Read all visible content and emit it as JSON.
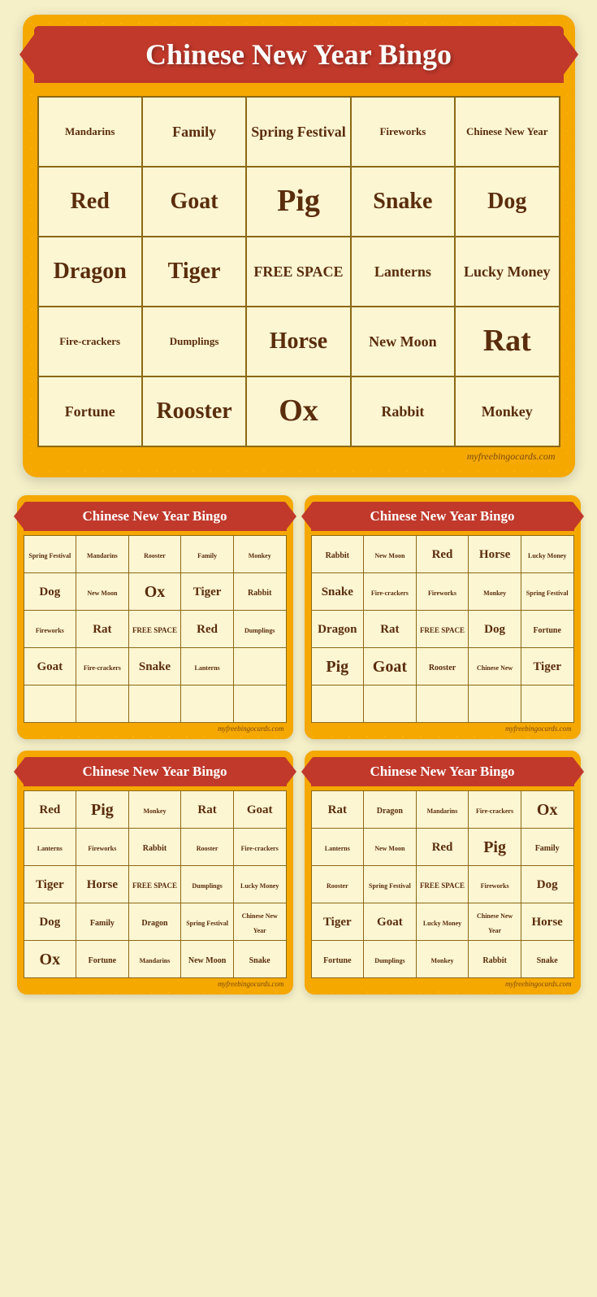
{
  "site": "myfreebingocards.com",
  "mainCard": {
    "title": "Chinese New Year Bingo",
    "rows": [
      [
        "Mandarins",
        "Family",
        "Spring Festival",
        "Fireworks",
        "Chinese New Year"
      ],
      [
        "Red",
        "Goat",
        "Pig",
        "Snake",
        "Dog"
      ],
      [
        "Dragon",
        "Tiger",
        "FREE SPACE",
        "Lanterns",
        "Lucky Money"
      ],
      [
        "Fire-crackers",
        "Dumplings",
        "Horse",
        "New Moon",
        "Rat"
      ],
      [
        "Fortune",
        "Rooster",
        "Ox",
        "Rabbit",
        "Monkey"
      ]
    ],
    "sizes": [
      [
        "sm",
        "md",
        "md",
        "sm",
        "sm"
      ],
      [
        "lg",
        "lg",
        "xl",
        "lg",
        "lg"
      ],
      [
        "lg",
        "lg",
        "free",
        "md",
        "md"
      ],
      [
        "sm",
        "sm",
        "lg",
        "md",
        "xl"
      ],
      [
        "md",
        "lg",
        "xl",
        "md",
        "md"
      ]
    ]
  },
  "card2": {
    "title": "Chinese New Year Bingo",
    "rows": [
      [
        "Spring Festival",
        "Mandarins",
        "Rooster",
        "Family",
        "Monkey"
      ],
      [
        "Dog",
        "New Moon",
        "Ox",
        "Tiger",
        "Rabbit"
      ],
      [
        "Fireworks",
        "Rat",
        "FREE SPACE",
        "Red",
        "Dumplings"
      ],
      [
        "Goat",
        "Fire-crackers",
        "Snake",
        "Lanterns",
        ""
      ],
      [
        "",
        "",
        "",
        "",
        ""
      ]
    ],
    "sizes": [
      [
        "sm",
        "sm",
        "sm",
        "sm",
        "sm"
      ],
      [
        "lg",
        "sm",
        "xl",
        "lg",
        "md"
      ],
      [
        "sm",
        "lg",
        "free",
        "lg",
        "sm"
      ],
      [
        "lg",
        "sm",
        "lg",
        "sm",
        "sm"
      ],
      [
        "sm",
        "sm",
        "sm",
        "sm",
        "sm"
      ]
    ]
  },
  "card3": {
    "title": "Chinese New Year Bingo",
    "rows": [
      [
        "Rabbit",
        "New Moon",
        "Red",
        "Horse",
        "Lucky Money"
      ],
      [
        "Snake",
        "Fire-crackers",
        "Fireworks",
        "Monkey",
        "Spring Festival"
      ],
      [
        "Dragon",
        "Rat",
        "FREE SPACE",
        "Dog",
        "Fortune"
      ],
      [
        "Pig",
        "Goat",
        "Rooster",
        "Chinese New",
        "Tiger"
      ],
      [
        "",
        "",
        "",
        "",
        ""
      ]
    ],
    "sizes": [
      [
        "md",
        "sm",
        "lg",
        "lg",
        "sm"
      ],
      [
        "lg",
        "sm",
        "sm",
        "sm",
        "sm"
      ],
      [
        "lg",
        "lg",
        "free",
        "lg",
        "md"
      ],
      [
        "xl",
        "xl",
        "md",
        "sm",
        "lg"
      ],
      [
        "sm",
        "sm",
        "sm",
        "sm",
        "sm"
      ]
    ]
  },
  "card4": {
    "title": "Chinese New Year Bingo",
    "rows": [
      [
        "Red",
        "Pig",
        "Monkey",
        "Rat",
        "Goat"
      ],
      [
        "Lanterns",
        "Fireworks",
        "Rabbit",
        "Rooster",
        "Fire-crackers"
      ],
      [
        "Tiger",
        "Horse",
        "FREE SPACE",
        "Dumplings",
        "Lucky Money"
      ],
      [
        "Dog",
        "Family",
        "Dragon",
        "Spring Festival",
        "Chinese New Year"
      ],
      [
        "Ox",
        "Fortune",
        "Mandarins",
        "New Moon",
        "Snake"
      ]
    ],
    "sizes": [
      [
        "lg",
        "xl",
        "sm",
        "lg",
        "lg"
      ],
      [
        "sm",
        "sm",
        "md",
        "sm",
        "sm"
      ],
      [
        "lg",
        "lg",
        "free",
        "sm",
        "sm"
      ],
      [
        "lg",
        "md",
        "md",
        "sm",
        "sm"
      ],
      [
        "xl",
        "md",
        "sm",
        "md",
        "md"
      ]
    ]
  },
  "card5": {
    "title": "Chinese New Year Bingo",
    "rows": [
      [
        "Rat",
        "Dragon",
        "Mandarins",
        "Fire-crackers",
        "Ox"
      ],
      [
        "Lanterns",
        "New Moon",
        "Red",
        "Pig",
        "Family"
      ],
      [
        "Rooster",
        "Spring Festival",
        "FREE SPACE",
        "Fireworks",
        "Dog"
      ],
      [
        "Tiger",
        "Goat",
        "Lucky Money",
        "Chinese New Year",
        "Horse"
      ],
      [
        "Fortune",
        "Dumplings",
        "Monkey",
        "Rabbit",
        "Snake"
      ]
    ],
    "sizes": [
      [
        "lg",
        "md",
        "sm",
        "sm",
        "xl"
      ],
      [
        "sm",
        "sm",
        "lg",
        "xl",
        "md"
      ],
      [
        "sm",
        "sm",
        "free",
        "sm",
        "lg"
      ],
      [
        "lg",
        "lg",
        "sm",
        "sm",
        "lg"
      ],
      [
        "md",
        "sm",
        "sm",
        "md",
        "md"
      ]
    ]
  }
}
